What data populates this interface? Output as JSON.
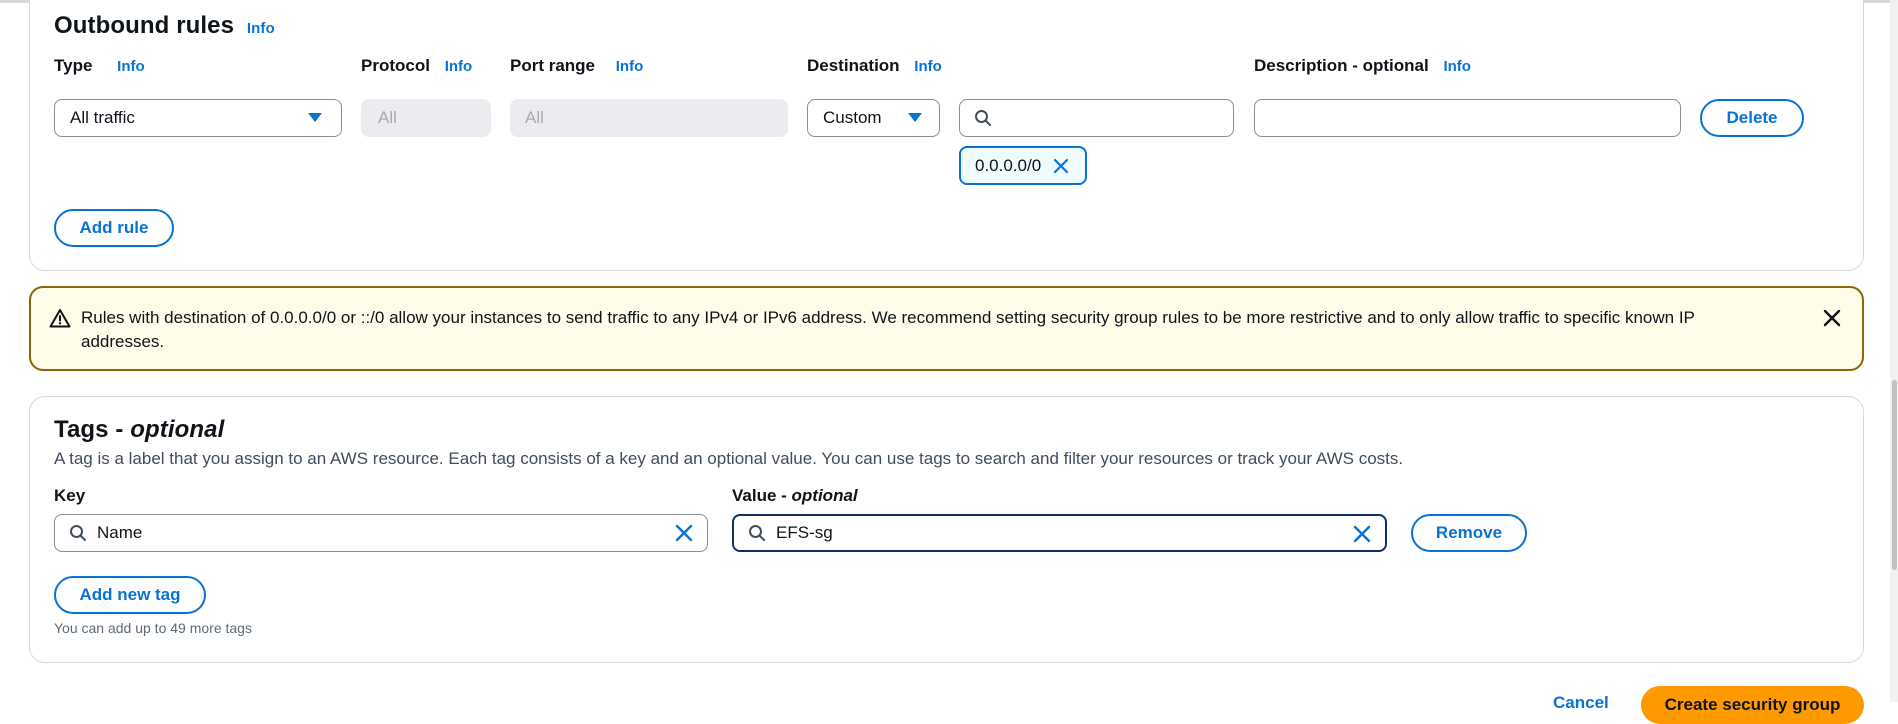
{
  "outbound": {
    "title": "Outbound rules",
    "info": "Info",
    "columns": {
      "type": "Type",
      "protocol": "Protocol",
      "port_range": "Port range",
      "destination": "Destination",
      "description": "Description - optional"
    },
    "rule": {
      "type_value": "All traffic",
      "protocol_value": "All",
      "port_value": "All",
      "destination_type": "Custom",
      "search_value": "",
      "description_value": "",
      "token": "0.0.0.0/0",
      "delete_label": "Delete"
    },
    "add_rule_label": "Add rule"
  },
  "alert": {
    "text": "Rules with destination of 0.0.0.0/0 or ::/0 allow your instances to send traffic to any IPv4 or IPv6 address. We recommend setting security group rules to be more restrictive and to only allow traffic to specific known IP addresses."
  },
  "tags": {
    "title_main": "Tags - ",
    "title_em": "optional",
    "description": "A tag is a label that you assign to an AWS resource. Each tag consists of a key and an optional value. You can use tags to search and filter your resources or track your AWS costs.",
    "key_label": "Key",
    "value_label_main": "Value - ",
    "value_label_em": "optional",
    "key_value": "Name",
    "value_value": "EFS-sg",
    "remove_label": "Remove",
    "add_label": "Add new tag",
    "limit_note": "You can add up to 49 more tags"
  },
  "footer": {
    "cancel_label": "Cancel",
    "create_label": "Create security group"
  },
  "colors": {
    "accent": "#0972d3",
    "warning_border": "#8d6605",
    "warning_bg": "#fffce9",
    "primary": "#ff9900"
  }
}
